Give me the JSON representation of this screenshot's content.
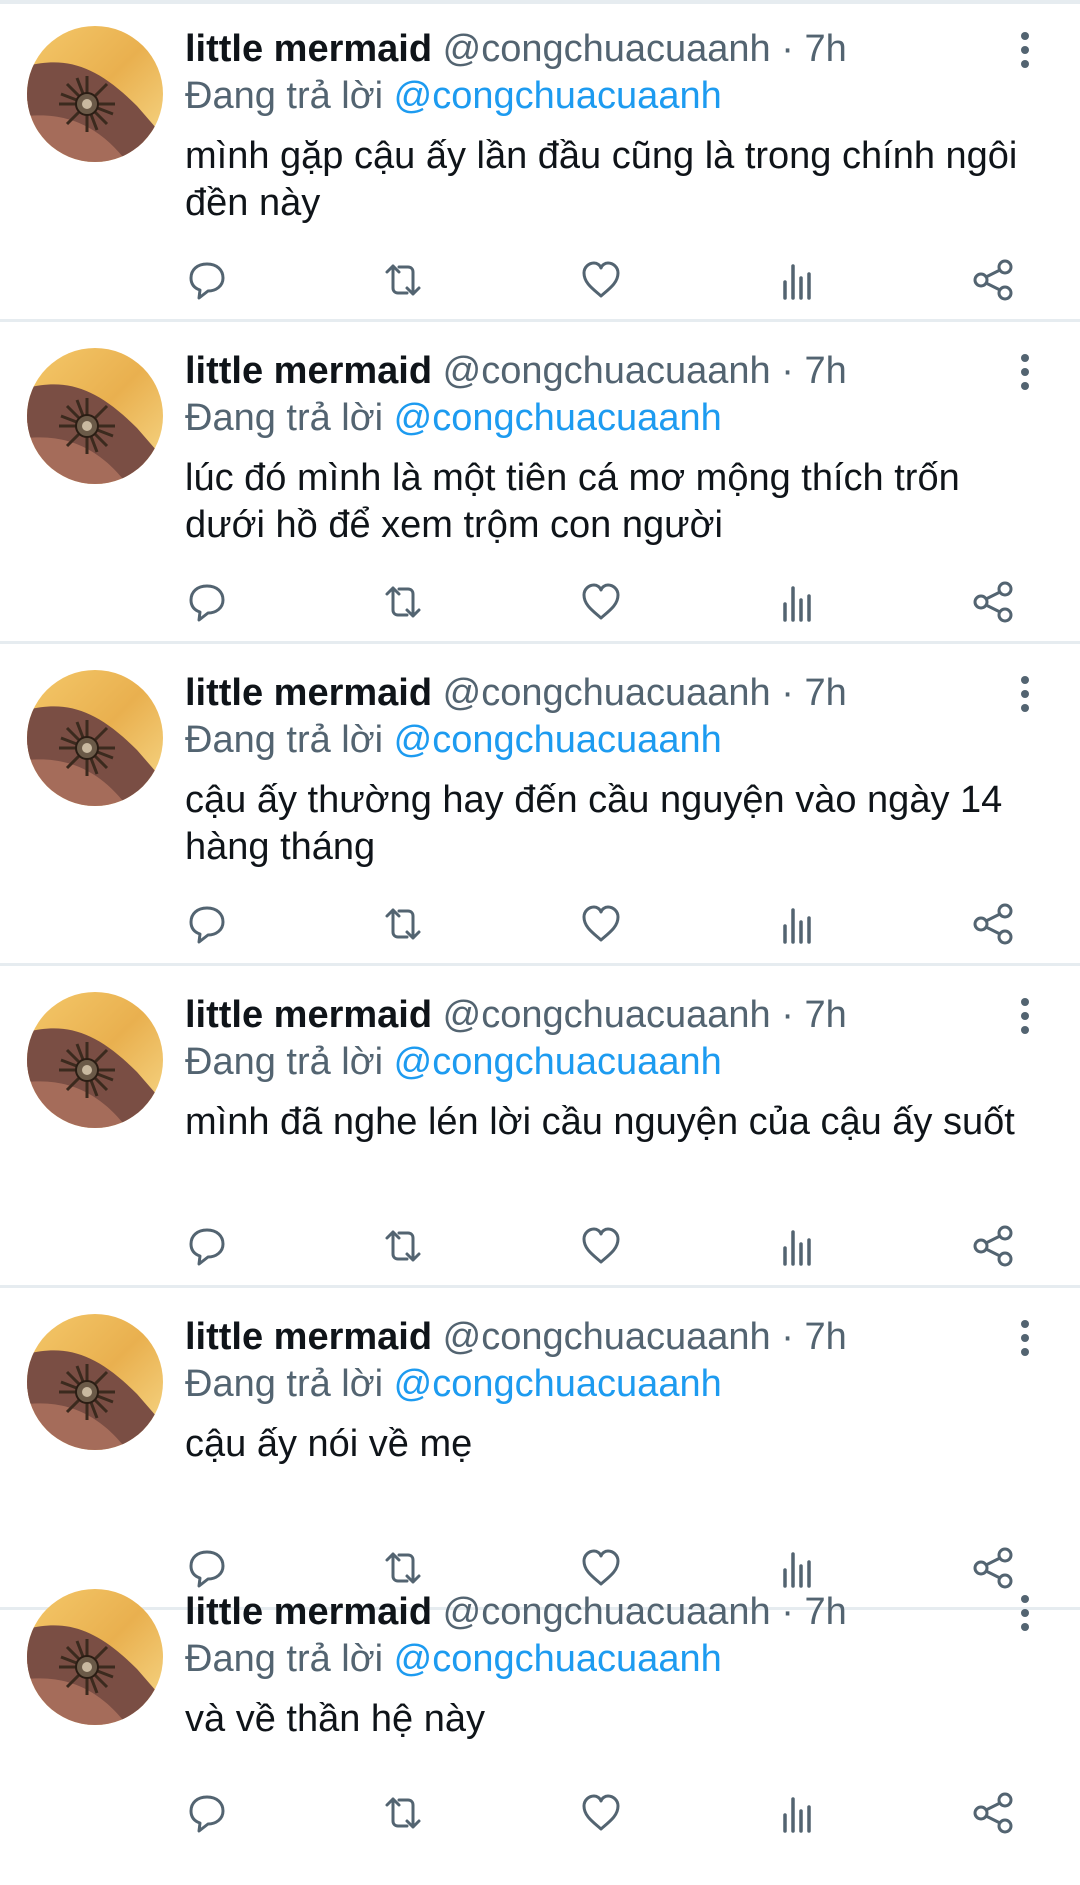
{
  "colors": {
    "text_primary": "#0f1419",
    "text_secondary": "#536471",
    "mention": "#1d9bf0",
    "divider": "#e6ecf0"
  },
  "tweets": [
    {
      "name": "little mermaid",
      "handle": "@congchuacuaanh",
      "dot": "·",
      "time": "7h",
      "reply_prefix": "Đang trả lời",
      "reply_to": "@congchuacuaanh",
      "text": "mình gặp cậu ấy lần đầu cũng là trong chính ngôi đền này"
    },
    {
      "name": "little mermaid",
      "handle": "@congchuacuaanh",
      "dot": "·",
      "time": "7h",
      "reply_prefix": "Đang trả lời",
      "reply_to": "@congchuacuaanh",
      "text": "lúc đó mình là một tiên cá mơ mộng thích trốn dưới hồ để xem trộm con người"
    },
    {
      "name": "little mermaid",
      "handle": "@congchuacuaanh",
      "dot": "·",
      "time": "7h",
      "reply_prefix": "Đang trả lời",
      "reply_to": "@congchuacuaanh",
      "text": "cậu ấy thường hay đến cầu nguyện vào ngày 14 hàng tháng"
    },
    {
      "name": "little mermaid",
      "handle": "@congchuacuaanh",
      "dot": "·",
      "time": "7h",
      "reply_prefix": "Đang trả lời",
      "reply_to": "@congchuacuaanh",
      "text": "mình đã nghe lén lời cầu nguyện của cậu ấy suốt"
    },
    {
      "name": "little mermaid",
      "handle": "@congchuacuaanh",
      "dot": "·",
      "time": "7h",
      "reply_prefix": "Đang trả lời",
      "reply_to": "@congchuacuaanh",
      "text": "cậu ấy nói về mẹ"
    },
    {
      "name": "little mermaid",
      "handle": "@congchuacuaanh",
      "dot": "·",
      "time": "7h",
      "reply_prefix": "Đang trả lời",
      "reply_to": "@congchuacuaanh",
      "text": "và về thần hệ này"
    }
  ],
  "icons": {
    "avatar": "avatar-ring-icon",
    "more": "more-vertical-icon",
    "reply": "reply-icon",
    "retweet": "retweet-icon",
    "like": "like-icon",
    "stats": "stats-icon",
    "share": "share-icon"
  }
}
